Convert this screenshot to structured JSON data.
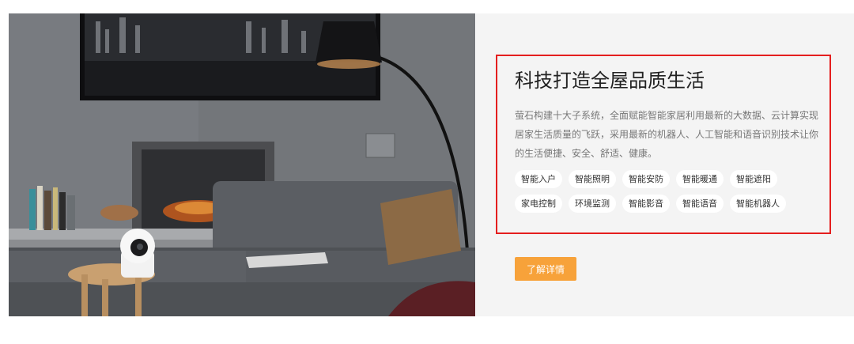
{
  "feature": {
    "title": "科技打造全屋品质生活",
    "description": "萤石构建十大子系统，全面赋能智能家居利用最新的大数据、云计算实现居家生活质量的飞跃，采用最新的机器人、人工智能和语音识别技术让你的生活便捷、安全、舒适、健康。",
    "tags": [
      "智能入户",
      "智能照明",
      "智能安防",
      "智能暖通",
      "智能遮阳",
      "家电控制",
      "环境监测",
      "智能影音",
      "智能语音",
      "智能机器人"
    ],
    "cta_label": "了解详情"
  },
  "colors": {
    "accent": "#f7a23a",
    "highlight_border": "#e41e1e",
    "panel_background": "#f4f4f4"
  }
}
